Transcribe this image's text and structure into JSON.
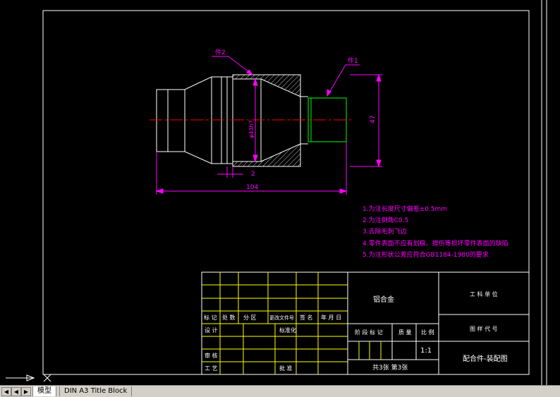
{
  "drawing": {
    "part_label_2": "件2",
    "part_label_1": "件1",
    "dim_diameter": "φ43h7",
    "dim_height": "47",
    "dim_gap": "2",
    "dim_length": "104"
  },
  "notes": [
    "1.为注长度尺寸偏差±0.5mm",
    "2.为注倒角C0.5",
    "3.去除毛刺飞边",
    "4.零件表面不应有划痕、擦伤等损坏零件表面的缺陷",
    "5.为注形状公差应符合GB1184-1980的要求"
  ],
  "title_block": {
    "material": "铝合金",
    "company_label": "工 科 单 位",
    "drawing_no_label": "图 样 代 号",
    "drawing_name": "配合件-装配图",
    "scale": "1:1",
    "sheets": "共3张   第3张",
    "stage_label": "阶 段 标 记",
    "weight_label": "质 量",
    "ratio_label": "比 例",
    "rev_headers": [
      "标 记",
      "处 数",
      "分 区",
      "更改文件号",
      "签 名",
      "年 月 日"
    ],
    "designer": "设 计",
    "standardization": "标准化",
    "review": "审 核",
    "process": "工 艺",
    "approve": "批 准"
  },
  "tabs": {
    "model": "模型",
    "layout": "DIN A3 Title Block"
  },
  "colors": {
    "outline": "#ffffff",
    "centerline": "#ff0000",
    "dimension": "#ff00ff",
    "part1": "#00ff00",
    "table": "#ffffff",
    "notes": "#ff00ff"
  }
}
